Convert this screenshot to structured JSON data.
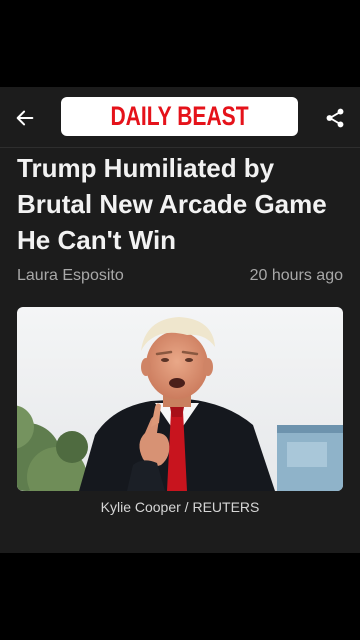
{
  "header": {
    "back_icon": "arrow-left-icon",
    "logo_text": "DAILY BEAST",
    "logo_color": "#e5121a",
    "share_icon": "share-icon"
  },
  "article": {
    "headline_lines": [
      "Trump Humiliated by",
      "Brutal New Arcade Game",
      "He Can't Win"
    ],
    "author": "Laura Esposito",
    "timestamp": "20 hours ago",
    "image_caption": "Kylie Cooper / REUTERS"
  },
  "colors": {
    "background": "#1c1c1c",
    "accent": "#e5121a",
    "text_primary": "#f2f2f2",
    "text_secondary": "#a8a8a8"
  }
}
